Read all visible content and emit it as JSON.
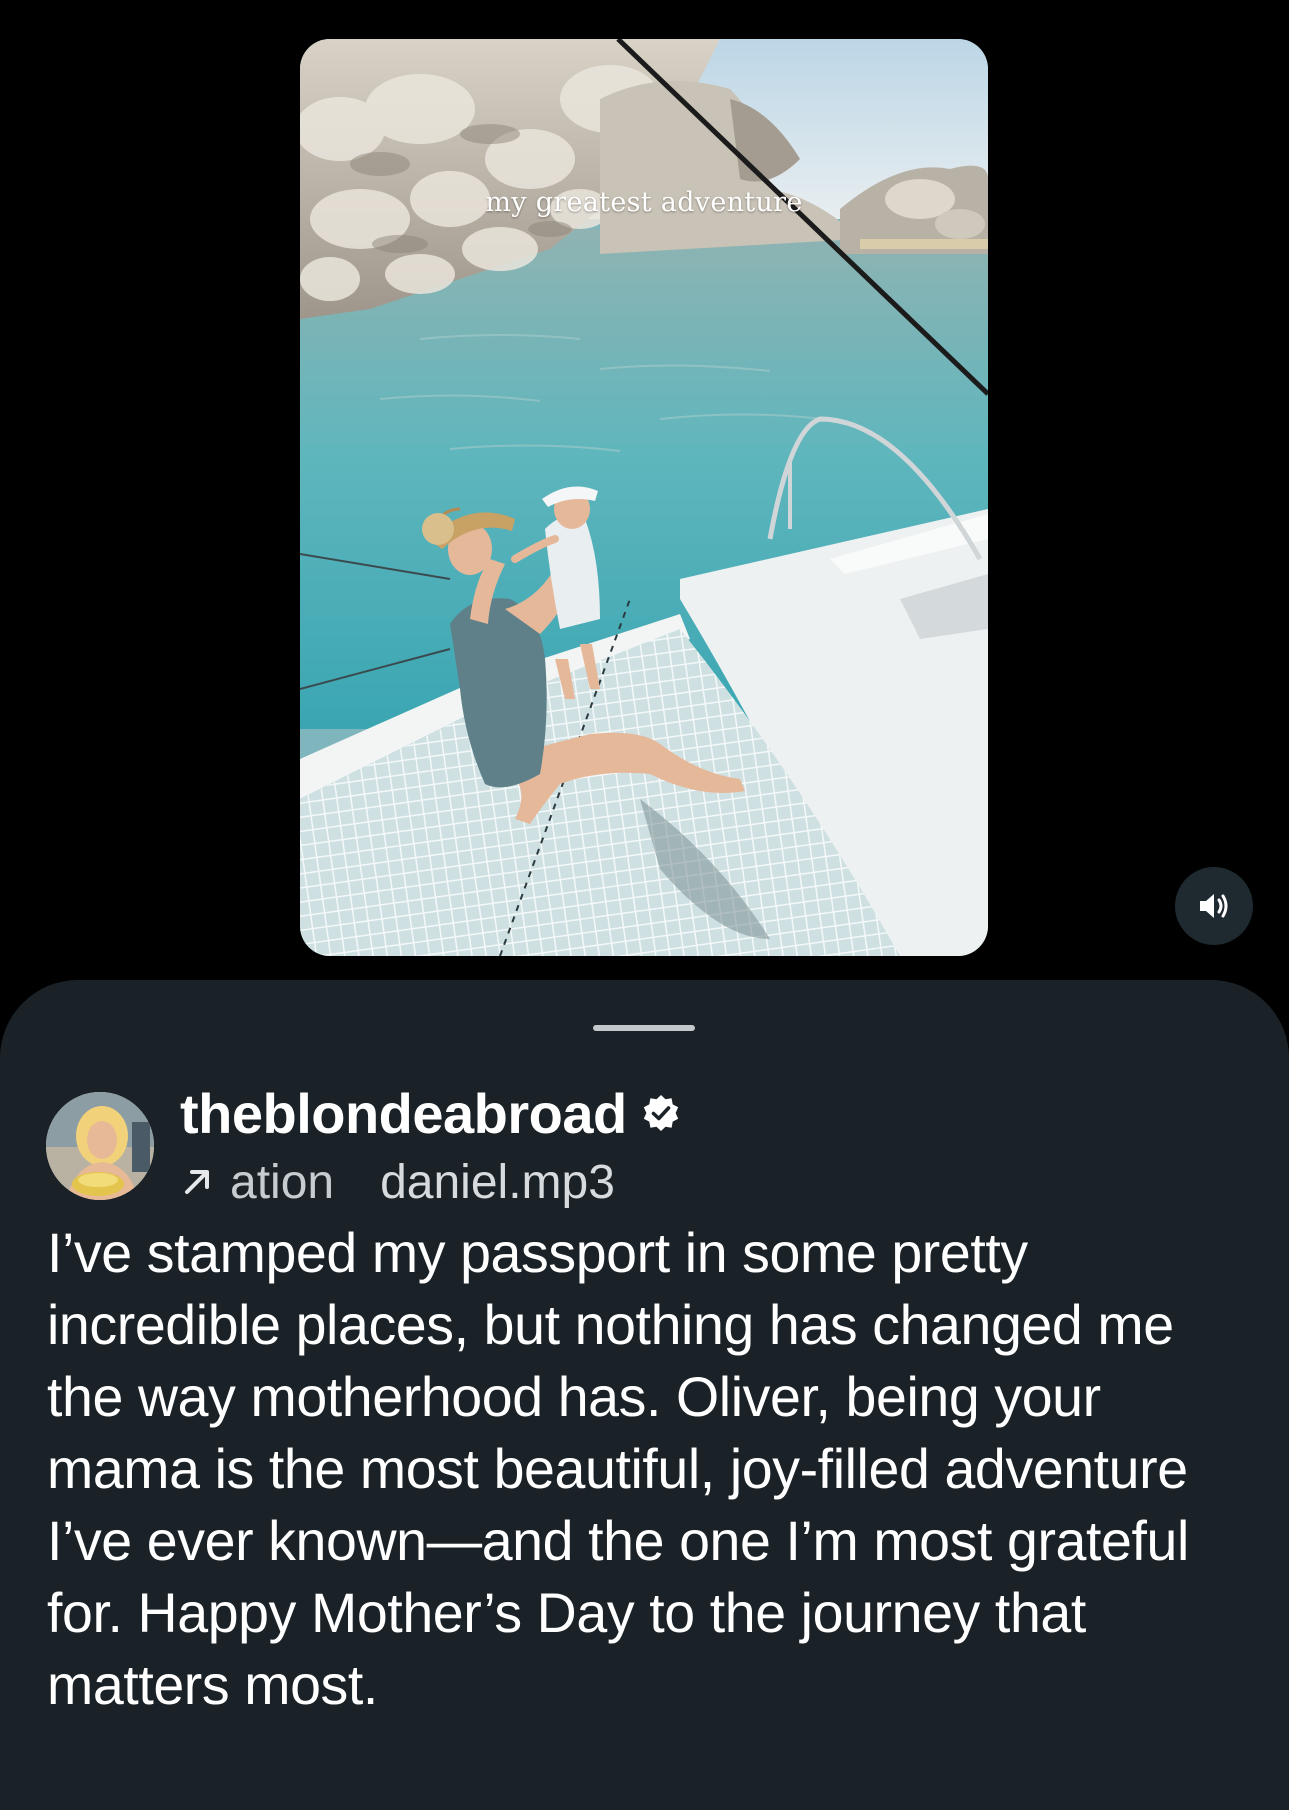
{
  "video": {
    "overlay_text": "my greatest adventure"
  },
  "controls": {
    "volume_icon": "speaker-volume-icon"
  },
  "post": {
    "username": "theblondeabroad",
    "verified_icon": "verified-badge-icon",
    "audio": {
      "arrow_icon": "arrow-up-right-icon",
      "track_part_1": "ation",
      "track_part_2": "daniel.mp3"
    },
    "caption": "I’ve stamped my passport in some pretty incredible places, but nothing has changed me the way motherhood has. Oliver, being your mama is the most beautiful, joy-filled adventure I’ve ever known—and the one I’m most grateful for. Happy Mother’s Day to the journey that matters most."
  },
  "colors": {
    "page_background": "#000000",
    "sheet_background": "#1b2227",
    "text_primary": "#ffffff",
    "text_secondary": "#cfd4d8",
    "volume_button_bg": "#1e2930"
  }
}
